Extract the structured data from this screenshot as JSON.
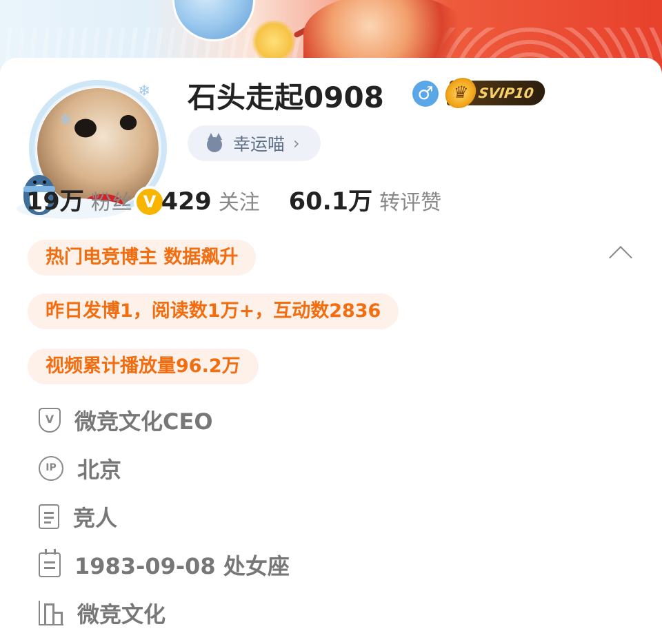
{
  "profile": {
    "username": "石头走起0908",
    "gender_symbol": "♂",
    "vip_label": "SVIP10",
    "verified_mark": "V",
    "badge_label": "幸运喵",
    "badge_chevron": "›"
  },
  "stats": [
    {
      "value": "19万",
      "label": "粉丝"
    },
    {
      "value": "429",
      "label": "关注"
    },
    {
      "value": "60.1万",
      "label": "转评赞"
    }
  ],
  "highlights": [
    "热门电竞博主 数据飙升",
    "昨日发博1，阅读数1万+，互动数2836",
    "视频累计播放量96.2万"
  ],
  "info": {
    "verification": "微竞文化CEO",
    "ip_location": "北京",
    "bio": "竞人",
    "birthday": "1983-09-08 处女座",
    "company": "微竞文化"
  },
  "icons": {
    "verification": "shield-v-icon",
    "ip_location": "ip-icon",
    "bio": "document-icon",
    "birthday": "calendar-icon",
    "company": "building-icon",
    "collapse": "chevron-up-icon"
  },
  "colors": {
    "highlight_text": "#f26d0f",
    "highlight_bg": "#fdf1ea",
    "verified_badge": "#f7b500",
    "gender_badge": "#5aa7e8",
    "vip_gold": "#f5cf6a"
  }
}
